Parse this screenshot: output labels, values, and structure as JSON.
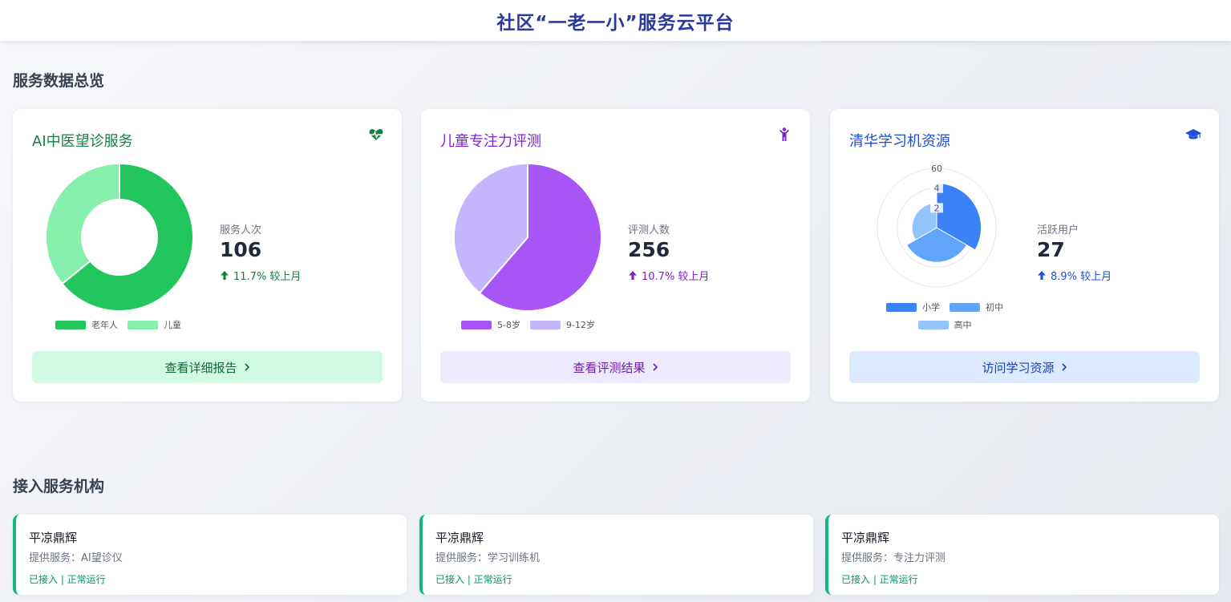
{
  "header": {
    "title": "社区“一老一小”服务云平台"
  },
  "overview": {
    "title": "服务数据总览"
  },
  "cards": [
    {
      "title": "AI中医望诊服务",
      "icon": "heartbeat-icon",
      "stat_label": "服务人次",
      "stat_value": "106",
      "change": "11.7% 较上月",
      "button": "查看详细报告",
      "accent": "#15803d",
      "chart_data": {
        "type": "pie",
        "variant": "donut",
        "categories": [
          "老年人",
          "儿童"
        ],
        "values": [
          68,
          38
        ],
        "colors": [
          "#22c55e",
          "#86efac"
        ],
        "legend": "bottom"
      }
    },
    {
      "title": "儿童专注力评测",
      "icon": "child-icon",
      "stat_label": "评测人数",
      "stat_value": "256",
      "change": "10.7% 较上月",
      "button": "查看评测结果",
      "accent": "#7e22ce",
      "chart_data": {
        "type": "pie",
        "categories": [
          "5-8岁",
          "9-12岁"
        ],
        "values": [
          157,
          99
        ],
        "colors": [
          "#a855f7",
          "#c4b5fd"
        ],
        "legend": "bottom"
      }
    },
    {
      "title": "清华学习机资源",
      "icon": "graduation-cap-icon",
      "stat_label": "活跃用户",
      "stat_value": "27",
      "change": "8.9% 较上月",
      "button": "访问学习资源",
      "accent": "#1d4ed8",
      "chart_data": {
        "type": "polar-area",
        "categories": [
          "小学",
          "初中",
          "高中"
        ],
        "values": [
          45,
          35,
          25
        ],
        "colors": [
          "#3b82f6",
          "#60a5fa",
          "#93c5fd"
        ],
        "radial_max": 60,
        "radial_ticks": [
          "60",
          "4",
          "2"
        ],
        "legend": "bottom"
      }
    }
  ],
  "organizations": {
    "title": "接入服务机构",
    "items": [
      {
        "name": "平凉鼎辉",
        "service": "提供服务：AI望诊仪",
        "status": "已接入 | 正常运行"
      },
      {
        "name": "平凉鼎辉",
        "service": "提供服务：学习训练机",
        "status": "已接入 | 正常运行"
      },
      {
        "name": "平凉鼎辉",
        "service": "提供服务：专注力评测",
        "status": "已接入 | 正常运行"
      }
    ]
  }
}
